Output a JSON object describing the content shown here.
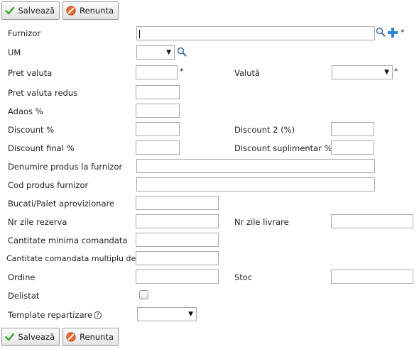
{
  "toolbar": {
    "save_label": "Salvează",
    "cancel_label": "Renunta"
  },
  "form": {
    "furnizor": {
      "label": "Furnizor",
      "value": "",
      "required": "*"
    },
    "um": {
      "label": "UM",
      "value": ""
    },
    "pret_valuta": {
      "label": "Pret valuta",
      "value": "",
      "required": "*"
    },
    "valuta": {
      "label": "Valută",
      "value": "",
      "required": "*"
    },
    "pret_valuta_redus": {
      "label": "Pret valuta redus",
      "value": ""
    },
    "adaos": {
      "label": "Adaos %",
      "value": ""
    },
    "discount": {
      "label": "Discount %",
      "value": ""
    },
    "discount2": {
      "label": "Discount 2 (%)",
      "value": ""
    },
    "discount_final": {
      "label": "Discount final %",
      "value": ""
    },
    "discount_suplimentar": {
      "label": "Discount suplimentar %",
      "value": ""
    },
    "denumire_produs": {
      "label": "Denumire produs la furnizor",
      "value": ""
    },
    "cod_produs": {
      "label": "Cod produs furnizor",
      "value": ""
    },
    "bucati_palet": {
      "label": "Bucati/Palet aprovizionare",
      "value": ""
    },
    "nr_zile_rezerva": {
      "label": "Nr zile rezerva",
      "value": ""
    },
    "nr_zile_livrare": {
      "label": "Nr zile livrare",
      "value": ""
    },
    "cantitate_minima": {
      "label": "Cantitate minima comandata",
      "value": ""
    },
    "cantitate_multiplu": {
      "label": "Cantitate comandata multiplu de",
      "value": ""
    },
    "ordine": {
      "label": "Ordine",
      "value": ""
    },
    "stoc": {
      "label": "Stoc",
      "value": ""
    },
    "delistat": {
      "label": "Delistat",
      "checked": false
    },
    "template_repartizare": {
      "label": "Template repartizare",
      "help": "?",
      "value": ""
    }
  },
  "icons": {
    "dropdown_arrow": "▼",
    "save": "check-icon",
    "cancel": "no-entry-icon",
    "search": "magnifier-icon",
    "add": "plus-icon",
    "help": "question-circle-icon"
  },
  "colors": {
    "save_check": "#3aa52f",
    "cancel_red": "#d9441c",
    "add_blue": "#2f86d6"
  }
}
